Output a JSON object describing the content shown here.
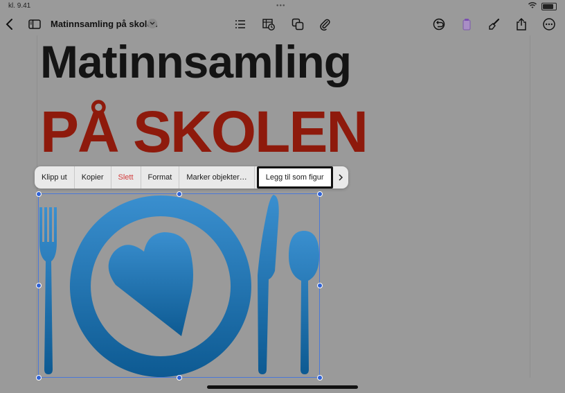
{
  "status": {
    "time": "kl. 9.41",
    "dots": "•••"
  },
  "toolbar": {
    "doc_title": "Matinnsamling på skolen"
  },
  "document": {
    "heading_line1": "Matinnsamling",
    "heading_line2": "PÅ SKOLEN"
  },
  "context_menu": {
    "items": [
      "Klipp ut",
      "Kopier",
      "Slett",
      "Format",
      "Marker objekter…",
      "Legg til som figur"
    ]
  },
  "colors": {
    "heading_red": "#8e1a0c",
    "graphic_blue": "#2f7fbf",
    "selection_blue": "#2f62d6",
    "delete_red": "#d23a3a"
  }
}
